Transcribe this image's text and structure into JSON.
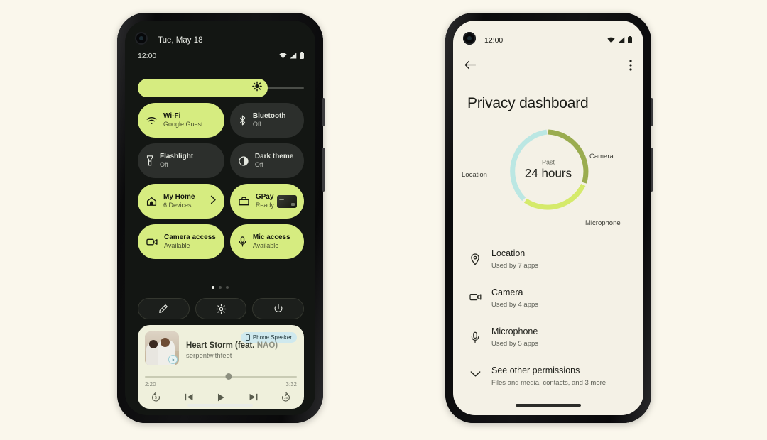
{
  "page": {
    "background_color": "#faf7ec"
  },
  "left_phone": {
    "name": "quick-settings-shade",
    "screen_background": "#131613",
    "accent_color": "#d6ec80",
    "status_bar": {
      "date": "Tue, May 18",
      "clock": "12:00",
      "icons": [
        "wifi-icon",
        "cellular-signal-icon",
        "battery-icon"
      ]
    },
    "brightness": {
      "name": "brightness-slider",
      "fill_percent": 78,
      "icon": "brightness-sun-icon"
    },
    "tiles": [
      {
        "title": "Wi-Fi",
        "subtitle": "Google Guest",
        "icon": "wifi-icon",
        "state": "on"
      },
      {
        "title": "Bluetooth",
        "subtitle": "Off",
        "icon": "bluetooth-icon",
        "state": "off"
      },
      {
        "title": "Flashlight",
        "subtitle": "Off",
        "icon": "flashlight-icon",
        "state": "off"
      },
      {
        "title": "Dark theme",
        "subtitle": "Off",
        "icon": "contrast-circle-icon",
        "state": "off"
      },
      {
        "title": "My Home",
        "subtitle": "6 Devices",
        "icon": "home-icon",
        "state": "on",
        "trailing": "chevron-right-icon"
      },
      {
        "title": "GPay",
        "subtitle": "Ready",
        "icon": "wallet-icon",
        "state": "on",
        "trailing": "credit-card-thumbnail"
      },
      {
        "title": "Camera access",
        "subtitle": "Available",
        "icon": "camera-icon",
        "state": "on"
      },
      {
        "title": "Mic access",
        "subtitle": "Available",
        "icon": "microphone-icon",
        "state": "on"
      }
    ],
    "page_dots": {
      "count": 3,
      "active_index": 0
    },
    "actions": [
      {
        "name": "edit-tiles-button",
        "icon": "pencil-icon"
      },
      {
        "name": "settings-button",
        "icon": "gear-icon"
      },
      {
        "name": "power-button",
        "icon": "power-icon"
      }
    ],
    "media": {
      "output_chip": {
        "label": "Phone Speaker",
        "icon": "phone-icon"
      },
      "title_main": "Heart Storm (feat.",
      "title_feat": "NAO)",
      "artist": "serpentwithfeet",
      "elapsed": "2:20",
      "duration": "3:32",
      "progress_percent": 55,
      "controls": [
        "replay-5-icon",
        "previous-track-icon",
        "play-icon",
        "next-track-icon",
        "forward-15-icon"
      ],
      "album_art_badge": "play-badge-icon",
      "page_dots": {
        "count": 3,
        "active_index": 0
      }
    }
  },
  "right_phone": {
    "name": "privacy-dashboard-screen",
    "screen_background": "#f4f1e6",
    "status_bar": {
      "clock": "12:00",
      "icons": [
        "wifi-icon",
        "cellular-signal-icon",
        "battery-icon"
      ]
    },
    "app_bar": {
      "back": "back-arrow-icon",
      "overflow": "more-vertical-icon"
    },
    "title": "Privacy dashboard",
    "chart_data": {
      "type": "pie",
      "title": "Past 24 hours permission usage",
      "center_label_top": "Past",
      "center_label_main": "24  hours",
      "categories": [
        "Camera",
        "Microphone",
        "Location"
      ],
      "values": [
        32,
        28,
        40
      ],
      "colors": [
        "#9aac4f",
        "#d5ea6b",
        "#b9e6e3"
      ],
      "start_angle_deg": 0,
      "labels": [
        {
          "text": "Camera",
          "position": "right-top"
        },
        {
          "text": "Microphone",
          "position": "right-bottom"
        },
        {
          "text": "Location",
          "position": "left"
        }
      ],
      "grid": false,
      "legend": "around-chart"
    },
    "permissions": [
      {
        "title": "Location",
        "subtitle": "Used by 7 apps",
        "icon": "location-pin-icon"
      },
      {
        "title": "Camera",
        "subtitle": "Used by 4 apps",
        "icon": "camera-icon"
      },
      {
        "title": "Microphone",
        "subtitle": "Used by 5 apps",
        "icon": "microphone-icon"
      },
      {
        "title": "See other permissions",
        "subtitle": "Files and media, contacts, and 3 more",
        "icon": "chevron-down-icon"
      }
    ]
  }
}
